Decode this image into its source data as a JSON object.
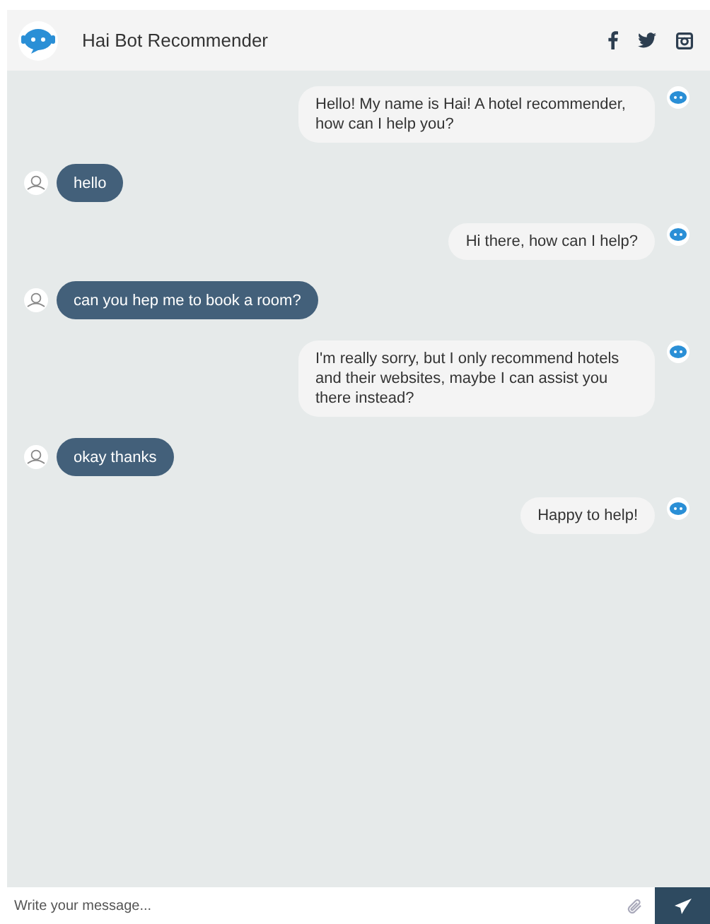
{
  "header": {
    "title": "Hai Bot Recommender"
  },
  "messages": [
    {
      "kind": "bot",
      "text": "Hello! My name is Hai! A hotel recommender, how can I help you?"
    },
    {
      "kind": "user",
      "text": "hello"
    },
    {
      "kind": "bot",
      "text": "Hi there, how can I help?"
    },
    {
      "kind": "user",
      "text": "can you hep me to book a room?"
    },
    {
      "kind": "bot",
      "text": "I'm really sorry, but I only recommend hotels and their websites, maybe I can assist you there instead?"
    },
    {
      "kind": "user",
      "text": "okay thanks"
    },
    {
      "kind": "bot",
      "text": "Happy to help!"
    }
  ],
  "composer": {
    "placeholder": "Write your message..."
  }
}
